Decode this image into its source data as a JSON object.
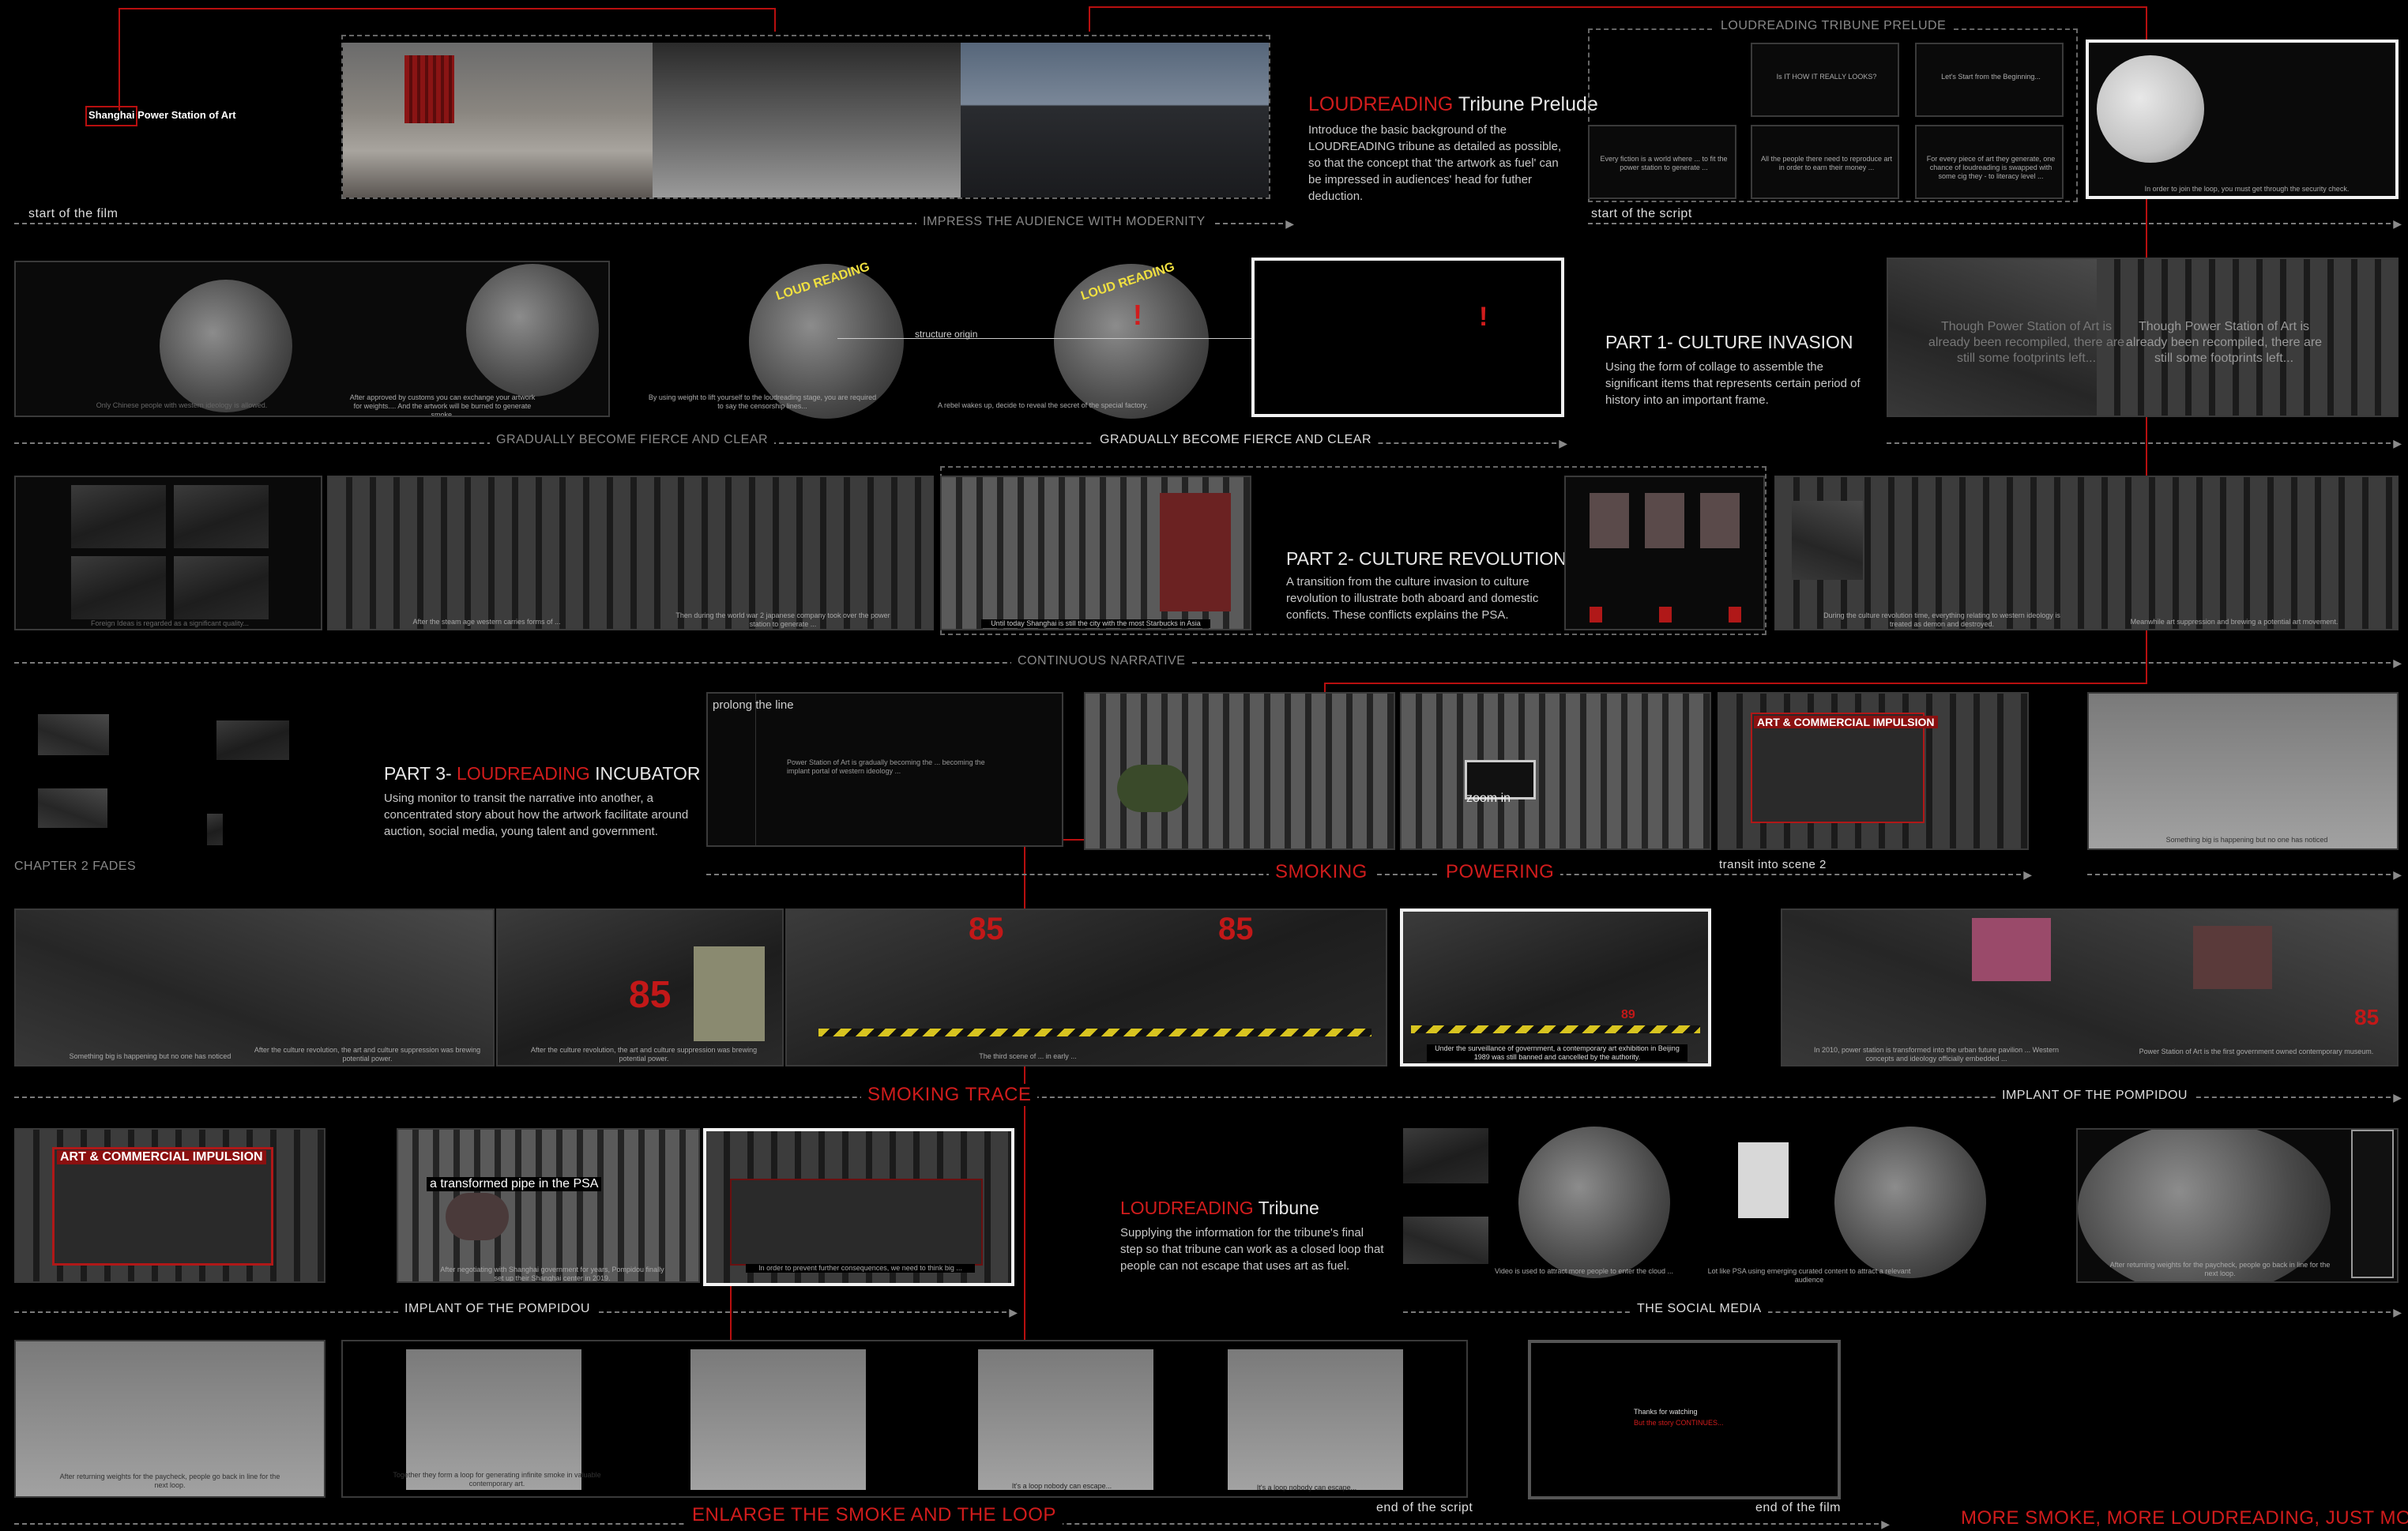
{
  "labels": {
    "psa_name": "Shanghai Power Station of Art",
    "start_film": "start of the film",
    "impress": "IMPRESS THE AUDIENCE WITH MODERNITY",
    "prelude_bar": "LOUDREADING TRIBUNE PRELUDE",
    "start_script": "start of the script",
    "gradually1": "GRADUALLY BECOME FIERCE AND CLEAR",
    "gradually2": "GRADUALLY BECOME FIERCE AND CLEAR",
    "structure_origin": "structure origin",
    "continuous": "CONTINUOUS NARRATIVE",
    "prolong": "prolong the line",
    "zoom_in": "zoom in",
    "smoking": "SMOKING",
    "powering": "POWERING",
    "transit_scene2": "transit into scene 2",
    "chapter2_fades": "CHAPTER 2 FADES",
    "smoking_trace": "SMOKING TRACE",
    "implant1": "IMPLANT OF THE POMPIDOU",
    "transformed_pipe": "a transformed pipe in the PSA",
    "implant2": "IMPLANT OF THE POMPIDOU",
    "social_media": "THE SOCIAL MEDIA",
    "enlarge": "ENLARGE THE SMOKE AND THE LOOP",
    "end_script": "end of the script",
    "end_film": "end of the film",
    "more_smoke": "MORE SMOKE, MORE LOUDREADING, JUST MORE..."
  },
  "sections": {
    "prelude": {
      "title_red": "LOUDREADING",
      "title_rest": " Tribune Prelude",
      "body": "Introduce the basic background of the LOUDREADING tribune as detailed as possible, so that the concept that 'the artwork as fuel' can be impressed in audiences' head for futher deduction."
    },
    "part1": {
      "title": "PART 1- CULTURE INVASION",
      "body": "Using the form of collage to assemble the significant items that represents certain period of history into an important frame."
    },
    "part2": {
      "title": "PART 2- CULTURE REVOLUTION",
      "body": "A transition from the culture invasion to culture revolution to illustrate both aboard and domestic conficts. These conflicts explains the PSA."
    },
    "part3": {
      "title_pre": "PART 3- ",
      "title_red": "LOUDREADING",
      "title_rest": " INCUBATOR",
      "body": "Using monitor to transit the narrative into another, a concentrated story about how the artwork facilitate around auction, social media, young talent and government."
    },
    "tribune": {
      "title_red": "LOUDREADING",
      "title_rest": " Tribune",
      "body": "Supplying the information for the tribune's final step so that tribune can work as a closed loop that people can not escape that uses art as fuel."
    }
  },
  "captions": {
    "script1": "Is IT HOW IT REALLY LOOKS?",
    "script2": "Let's Start from the Beginning...",
    "script3": "Every fiction is a world where ... to fit the power station to generate ...",
    "script4": "All the people there need to reproduce art in order to earn their money ...",
    "script5": "For every piece of art they generate, one chance of loudreading is swapped with some cig they - to literacy level ...",
    "security": "In order to join the loop, you must get through the security check.",
    "r2a": "Only Chinese people with western ideology is allowed.",
    "r2b": "After approved by customs you can exchange your artwork for weights.... And the artwork will be burned to generate smoke.",
    "r2c": "By using weight to lift yourself to the loudreading stage, you are required to say the censorship lines...",
    "r2d": "A rebel wakes up, decide to reveal the secret of the special factory.",
    "loud_reading": "LOUD READING",
    "invasion_text": "Though Power Station of Art is already been recompiled, there are still some footprints left...",
    "r3a": "Foreign Ideas is regarded as a significant quality...",
    "r3b": "After the steam age western carries forms of ...",
    "r3c": "Then during the world war 2 japanese company took over the power station to generate ...",
    "r3d": "Until today Shanghai is still the city with the most Starbucks in Asia",
    "r3e": "During the culture revolution time, everything relating to western ideology is treated as demon and destroyed.",
    "r3f": "Meanwhile art suppression and brewing a potential art movement.",
    "incubator_text": "Power Station of Art is gradually becoming the ... becoming the implant portal of western ideology ...",
    "r4right": "Something big is happening but no one has noticed",
    "r5a": "Something big is happening but no one has noticed",
    "r5b": "After the culture revolution, the art and culture suppression was brewing potential power.",
    "r5c": "After the culture revolution, the art and culture suppression was brewing potential power.",
    "r5d": "The third scene of ... in early ...",
    "r5e": "Under the surveillance of government, a contemporary art exhibition in Beijing 1989 was still banned and cancelled by the authority.",
    "r5f": "In 2010, power station is transformed into the urban future pavilion ... Western concepts and ideology officially embedded ...",
    "r5g": "Power Station of Art is the first government owned contemporary museum.",
    "art_banner": "ART & COMMERCIAL IMPULSION",
    "num_85": "85",
    "num_89": "89",
    "r6a": "After negotiating with Shanghai government for years, Pompidou finally set up their Shanghai center in 2019.",
    "r6b": "In order to prevent further consequences, we need to think big ...",
    "r6c": "Video is used to attract more people to enter the cloud ...",
    "r6d": "Lot like PSA using emerging curated content to attract a relevant audience",
    "r6e": "After returning weights for the paycheck, people go back in line for the next loop.",
    "r7a": "After returning weights for the paycheck, people go back in line for the next loop.",
    "r7b": "Together they form a loop for generating infinite smoke in valuable contemporary art.",
    "r7c": "It's a loop nobody can escape...",
    "r7d": "It's a loop nobody can escape...",
    "thanks1": "Thanks for watching",
    "thanks2": "But the story CONTINUES..."
  },
  "colors": {
    "accent_red": "#d11c1c",
    "background": "#000000",
    "frame_white": "#f2f2f2",
    "timeline_gray": "#7a7a7a"
  }
}
